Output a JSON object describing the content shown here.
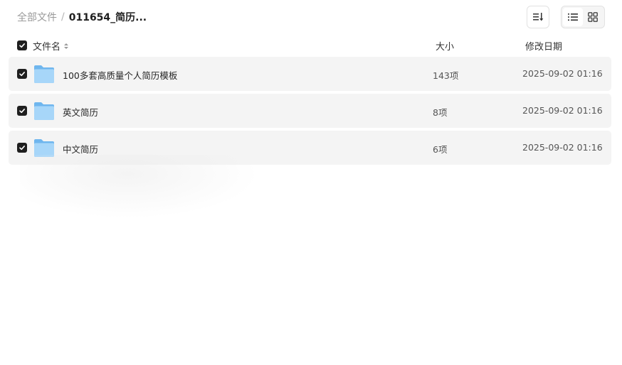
{
  "breadcrumb": {
    "root": "全部文件",
    "separator": "/",
    "current": "011654_简历..."
  },
  "table": {
    "headers": {
      "name": "文件名",
      "size": "大小",
      "date": "修改日期"
    },
    "rows": [
      {
        "name": "100多套高质量个人简历模板",
        "count": "143项",
        "date": "2025-09-02 01:16"
      },
      {
        "name": "英文简历",
        "count": "8项",
        "date": "2025-09-02 01:16"
      },
      {
        "name": "中文简历",
        "count": "6项",
        "date": "2025-09-02 01:16"
      }
    ]
  },
  "colors": {
    "checkbox": "#1f1f1f",
    "row_bg": "#f4f4f4",
    "folder": "#8cc8f5"
  },
  "icons": {
    "sort": "sort-lines-icon",
    "list_view": "list-view-icon",
    "grid_view": "grid-view-icon",
    "folder": "folder-icon"
  }
}
